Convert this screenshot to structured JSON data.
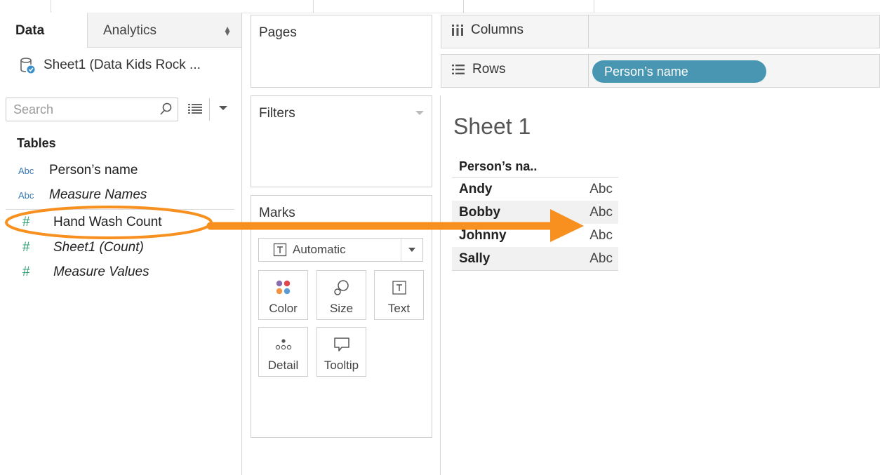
{
  "data_pane": {
    "tabs": [
      {
        "label": "Data"
      },
      {
        "label": "Analytics"
      }
    ],
    "datasource": "Sheet1 (Data Kids Rock ...",
    "search": {
      "placeholder": "Search",
      "value": ""
    },
    "tables_heading": "Tables",
    "fields": [
      {
        "label": "Person’s name",
        "type": "dimension",
        "type_label": "Abc"
      },
      {
        "label": "Measure Names",
        "type": "dimension",
        "type_label": "Abc"
      },
      {
        "label": "Hand Wash Count",
        "type": "measure",
        "type_label": "#"
      },
      {
        "label": "Sheet1 (Count)",
        "type": "measure",
        "type_label": "#"
      },
      {
        "label": "Measure Values",
        "type": "measure",
        "type_label": "#"
      }
    ]
  },
  "cards": {
    "pages": "Pages",
    "filters": "Filters",
    "marks": {
      "title": "Marks",
      "mark_type": "Automatic",
      "buttons": [
        {
          "label": "Color"
        },
        {
          "label": "Size"
        },
        {
          "label": "Text"
        },
        {
          "label": "Detail"
        },
        {
          "label": "Tooltip"
        }
      ]
    }
  },
  "shelves": {
    "columns_label": "Columns",
    "rows_label": "Rows",
    "rows_pill": "Person’s name"
  },
  "view": {
    "title": "Sheet 1",
    "header": "Person’s na..",
    "rows": [
      {
        "name": "Andy",
        "value": "Abc"
      },
      {
        "name": "Bobby",
        "value": "Abc"
      },
      {
        "name": "Johnny",
        "value": "Abc"
      },
      {
        "name": "Sally",
        "value": "Abc"
      }
    ]
  },
  "annotation": {
    "color": "#f7901e"
  }
}
